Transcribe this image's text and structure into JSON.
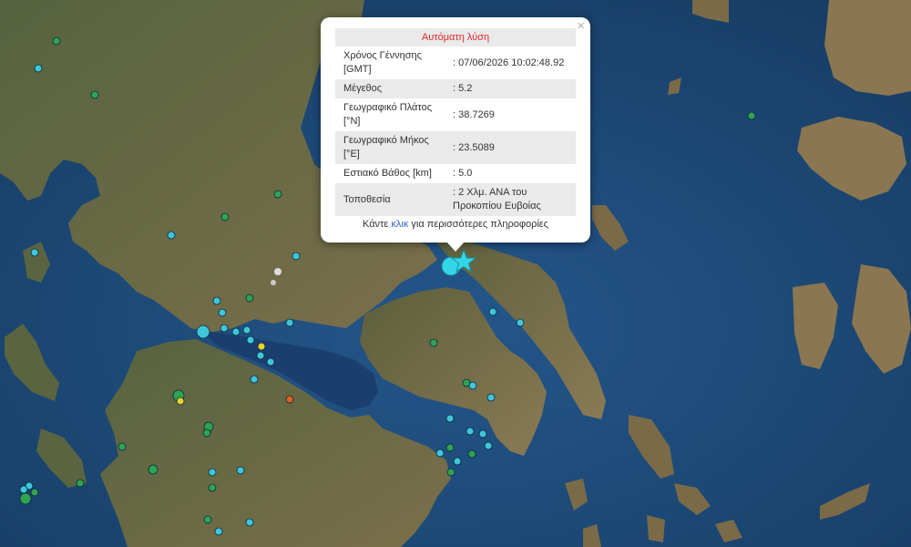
{
  "popup": {
    "title": "Αυτόματη λύση",
    "close_symbol": "×",
    "rows": [
      {
        "label": "Χρόνος Γέννησης [GMT]",
        "value": ": 07/06/2026 10:02:48.92"
      },
      {
        "label": "Μέγεθος",
        "value": ": 5.2"
      },
      {
        "label": "Γεωγραφικό Πλάτος [°N]",
        "value": ": 38.7269"
      },
      {
        "label": "Γεωγραφικό Μήκος [°E]",
        "value": ": 23.5089"
      },
      {
        "label": "Εστιακό Βάθος [km]",
        "value": ": 5.0"
      },
      {
        "label": "Τοποθεσία",
        "value": ": 2 Χλμ. ΑΝΑ του Προκοπίου Ευβοίας"
      }
    ],
    "more_prefix": "Κάντε ",
    "more_link": "κλικ",
    "more_suffix": " για περισσότερες πληροφορίες"
  },
  "map": {
    "sea_color": "#1d4a78",
    "land_color": "#4d5a36",
    "epicenter_color": "#33d6e6",
    "marker_colors": {
      "cyan": "#3fc6d9",
      "green": "#2fa34f",
      "yellow": "#e8d22b",
      "orange": "#e0621e"
    }
  }
}
